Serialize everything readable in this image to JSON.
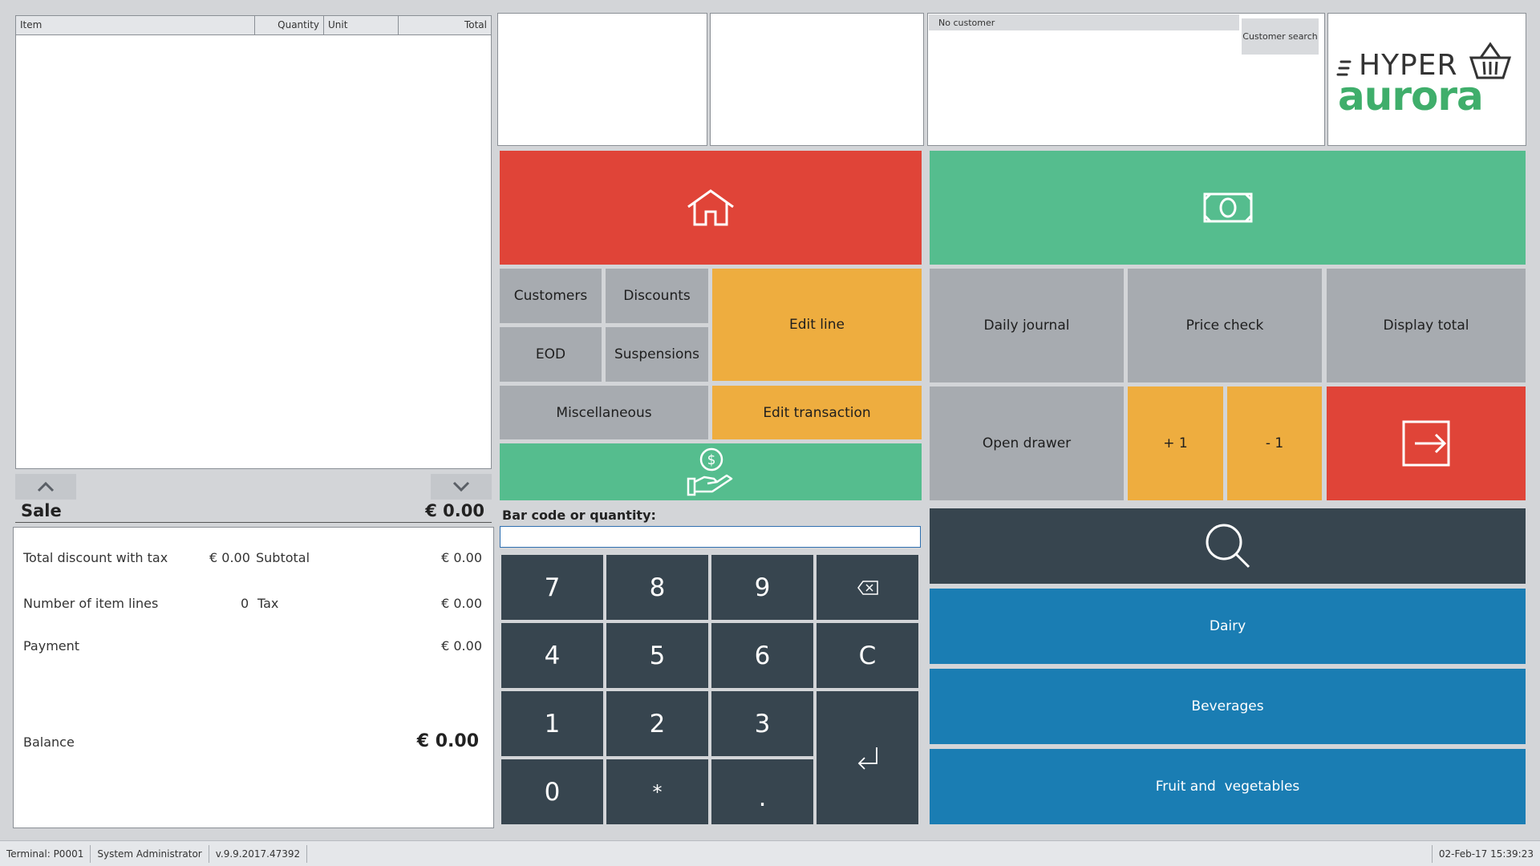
{
  "grid": {
    "col_item": "Item",
    "col_quantity": "Quantity",
    "col_unit": "Unit",
    "col_total": "Total"
  },
  "sale": {
    "label": "Sale",
    "total": "€ 0.00"
  },
  "summary": {
    "total_discount_label": "Total discount with tax",
    "total_discount_value": "€ 0.00",
    "subtotal_label": "Subtotal",
    "subtotal_value": "€ 0.00",
    "item_lines_label": "Number of item lines",
    "item_lines_value": "0",
    "tax_label": "Tax",
    "tax_value": "€ 0.00",
    "payment_label": "Payment",
    "payment_value": "€ 0.00",
    "balance_label": "Balance",
    "balance_value": "€ 0.00"
  },
  "customer": {
    "name": "No customer",
    "search_button": "Customer search"
  },
  "logo": {
    "line1": "HYPER",
    "line2": "aurora"
  },
  "buttons": {
    "customers": "Customers",
    "discounts": "Discounts",
    "edit_line": "Edit line",
    "eod": "EOD",
    "suspensions": "Suspensions",
    "miscellaneous": "Miscellaneous",
    "edit_transaction": "Edit transaction",
    "daily_journal": "Daily journal",
    "price_check": "Price check",
    "display_total": "Display total",
    "open_drawer": "Open drawer",
    "plus_one": "+ 1",
    "minus_one": "- 1"
  },
  "barcode": {
    "label": "Bar code or quantity:",
    "value": ""
  },
  "numpad": {
    "k7": "7",
    "k8": "8",
    "k9": "9",
    "k4": "4",
    "k5": "5",
    "k6": "6",
    "clear": "C",
    "k1": "1",
    "k2": "2",
    "k3": "3",
    "k0": "0",
    "star": "*",
    "dot": "."
  },
  "categories": [
    "Dairy",
    "Beverages",
    "Fruit and  vegetables"
  ],
  "status": {
    "terminal": "Terminal: P0001",
    "user": "System Administrator",
    "version": "v.9.9.2017.47392",
    "datetime": "02-Feb-17 15:39:23"
  },
  "colors": {
    "red": "#e04438",
    "green": "#55bd8e",
    "orange": "#eead3f",
    "grey": "#a7abb0",
    "dark": "#37454f",
    "blue": "#1a7db3",
    "logo_green": "#3fae6b"
  },
  "icons": [
    "home-icon",
    "cash-icon",
    "payment-hand-icon",
    "logout-icon",
    "search-icon",
    "backspace-icon",
    "enter-icon",
    "basket-icon",
    "chevron-up-icon",
    "chevron-down-icon"
  ]
}
